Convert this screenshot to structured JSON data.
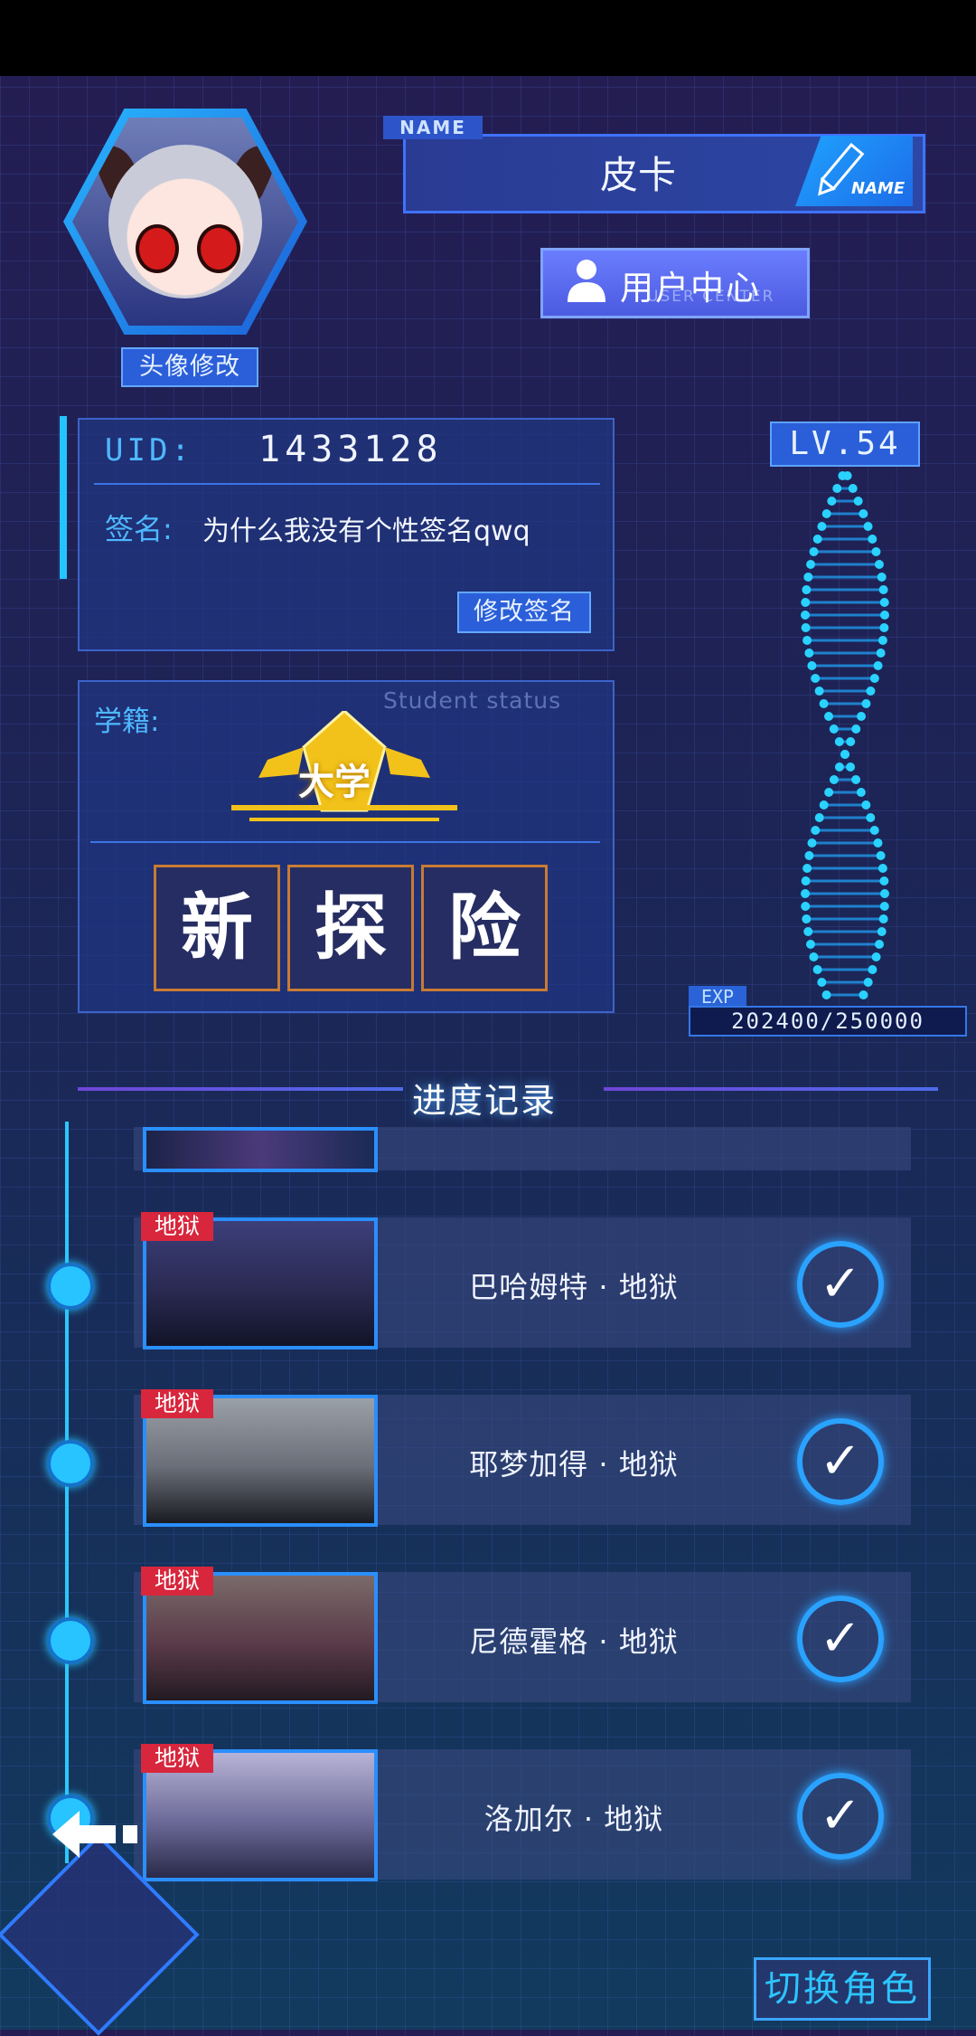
{
  "profile": {
    "name": "皮卡",
    "name_label": "NAME",
    "avatar_button": "头像修改",
    "user_center": "用户中心",
    "user_center_en": "USER CENTER",
    "uid_label": "UID:",
    "uid": "1433128",
    "signature_label": "签名:",
    "signature": "为什么我没有个性签名qwq",
    "edit_signature_button": "修改签名"
  },
  "student": {
    "label": "学籍:",
    "label_en": "Student status",
    "badge": "大学",
    "tiles": [
      "新",
      "探",
      "险"
    ]
  },
  "level": {
    "label": "LV.54",
    "exp_label": "EXP",
    "exp": "202400/250000",
    "exp_fraction": 0.8096
  },
  "progress": {
    "title": "进度记录",
    "records": [
      {
        "tag": "地狱",
        "title": "巴哈姆特 · 地狱",
        "completed": true
      },
      {
        "tag": "地狱",
        "title": "耶梦加得 · 地狱",
        "completed": true
      },
      {
        "tag": "地狱",
        "title": "尼德霍格 · 地狱",
        "completed": true
      },
      {
        "tag": "地狱",
        "title": "洛加尔 · 地狱",
        "completed": true
      }
    ]
  },
  "footer": {
    "switch_role_button": "切换角色"
  },
  "colors": {
    "accent": "#27c4ff",
    "hell_tag": "#d8263c",
    "tile_border": "#c87b34"
  }
}
